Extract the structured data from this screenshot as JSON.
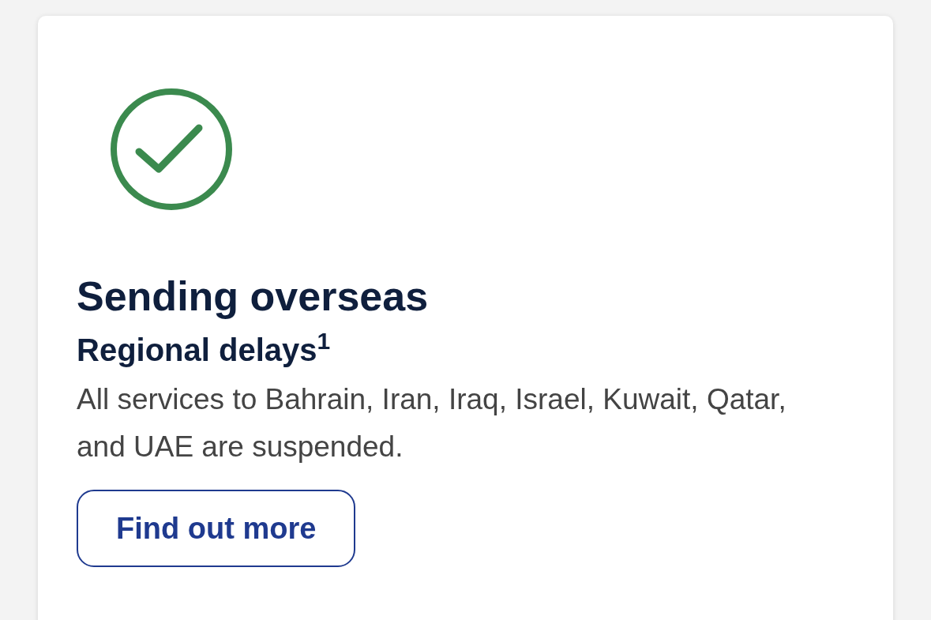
{
  "card": {
    "title": "Sending overseas",
    "subtitle": "Regional delays$^{1}$",
    "message": "All services to Bahrain, Iran, Iraq, Israel, Kuwait, Qatar, and UAE are suspended.",
    "button": {
      "label": "Find out more"
    }
  }
}
